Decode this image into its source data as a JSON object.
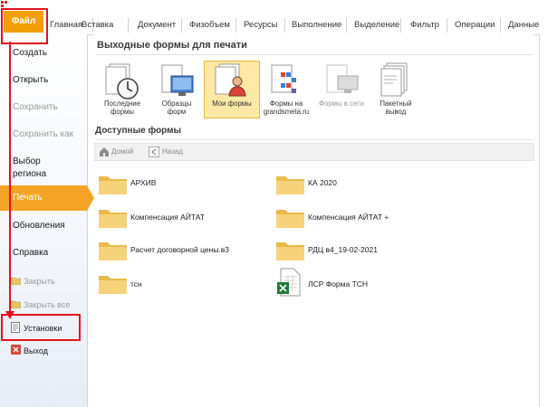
{
  "ribbon": {
    "file_tab": "Файл",
    "tabs": [
      "Главная",
      "Вставка",
      "Документ",
      "Физобъем",
      "Ресурсы",
      "Выполнение",
      "Выделение",
      "Фильтр",
      "Операции",
      "Данные"
    ]
  },
  "backstage": {
    "items": [
      "Создать",
      "Открыть",
      "Сохранить",
      "Сохранить как",
      "Выбор",
      "региона",
      "Печать",
      "Обновления",
      "Справка",
      "Закрыть",
      "Закрыть все",
      "Установки",
      "Выход"
    ],
    "active": "Печать"
  },
  "main": {
    "output_title": "Выходные формы для печати",
    "forms": [
      {
        "label1": "Последние",
        "label2": "формы",
        "icon": "recent-clock-icon",
        "disabled": false
      },
      {
        "label1": "Образцы",
        "label2": "форм",
        "icon": "samples-monitor-icon",
        "disabled": false
      },
      {
        "label1": "Мои формы",
        "label2": "",
        "icon": "my-forms-user-icon",
        "disabled": false
      },
      {
        "label1": "Формы на",
        "label2": "grandsmeta.ru",
        "icon": "online-forms-icon",
        "disabled": false
      },
      {
        "label1": "Формы в сети",
        "label2": "",
        "icon": "network-forms-icon",
        "disabled": true
      },
      {
        "label1": "Пакетный",
        "label2": "вывод",
        "icon": "batch-output-icon",
        "disabled": false
      }
    ],
    "available_title": "Доступные формы",
    "nav": {
      "home": "Домой",
      "back": "Назад"
    },
    "folders": [
      {
        "name": "АРХИВ",
        "type": "folder"
      },
      {
        "name": "КА 2020",
        "type": "folder"
      },
      {
        "name": "Компенсация АЙТАТ",
        "type": "folder"
      },
      {
        "name": "Компенсация АЙТАТ +",
        "type": "folder"
      },
      {
        "name": "Расчет договорной цены.в3",
        "type": "folder"
      },
      {
        "name": "РДЦ в4_19-02-2021",
        "type": "folder"
      },
      {
        "name": "тсн",
        "type": "folder"
      },
      {
        "name": "ЛСР Форма ТСН",
        "type": "excel-file"
      }
    ]
  },
  "colors": {
    "accent": "#f4a424",
    "annotation": "#e0121f",
    "folder": "#f3c75a"
  }
}
